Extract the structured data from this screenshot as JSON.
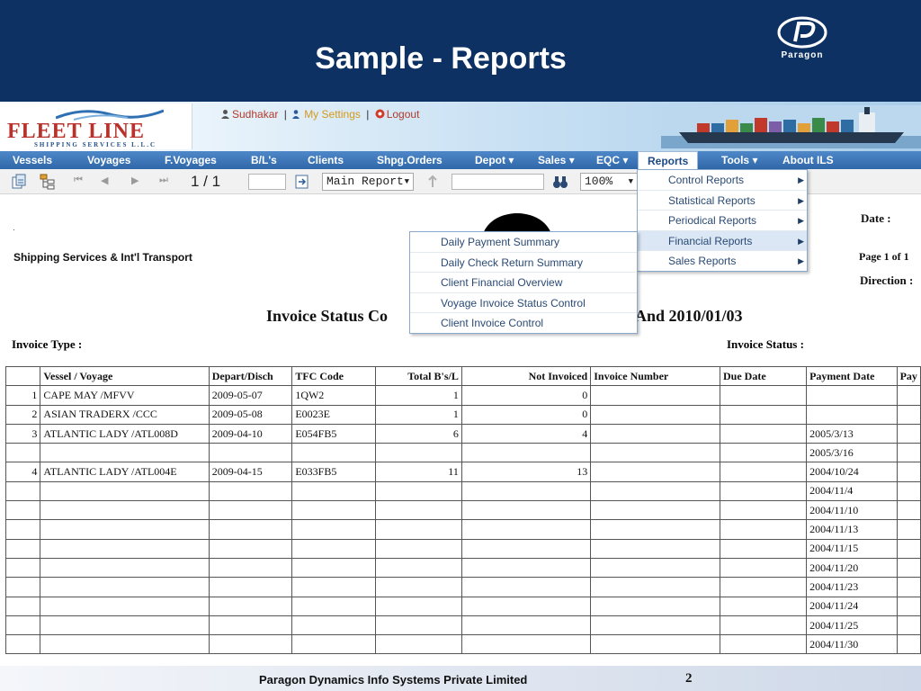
{
  "slide": {
    "title": "Sample - Reports",
    "brand_name": "Paragon",
    "footer": "Paragon Dynamics Info Systems Private Limited",
    "page_number": "2"
  },
  "app": {
    "logo_text": "FLEET LINE",
    "logo_subtext": "SHIPPING SERVICES L.L.C",
    "user_links": [
      "Sudhakar",
      "My Settings",
      "Logout"
    ]
  },
  "nav": [
    "Vessels",
    "Voyages",
    "F.Voyages",
    "B/L's",
    "Clients",
    "Shpg.Orders",
    "Depot ▾",
    "Sales ▾",
    "EQC ▾",
    "Reports",
    "Tools ▾",
    "About ILS"
  ],
  "toolbar": {
    "page_counter": "1 / 1",
    "report_select": "Main Report",
    "zoom": "100%"
  },
  "menus": {
    "reports": [
      "Control Reports",
      "Statistical Reports",
      "Periodical Reports",
      "Financial Reports",
      "Sales Reports"
    ],
    "financial": [
      "Daily Payment Summary",
      "Daily Check Return Summary",
      "Client Financial Overview",
      "Voyage Invoice Status Control",
      "Client Invoice Control"
    ]
  },
  "report": {
    "company": "Shipping Services & Int'l Transport",
    "date_label": "Date :",
    "page_label": "Page 1 of 1",
    "direction_label": "Direction :",
    "title_left": "Invoice Status Co",
    "title_right": "And  2010/01/03",
    "invoice_type_label": "Invoice Type :",
    "invoice_status_label": "Invoice Status :",
    "columns": [
      "",
      "Vessel / Voyage",
      "Depart/Disch",
      "TFC Code",
      "Total B's/L",
      "Not Invoiced",
      "Invoice Number",
      "Due Date",
      "Payment Date",
      "Pay"
    ],
    "rows": [
      [
        "1",
        "CAPE MAY /MFVV",
        "2009-05-07",
        "1QW2",
        "1",
        "0",
        "",
        "",
        "",
        ""
      ],
      [
        "2",
        "ASIAN TRADERX /CCC",
        "2009-05-08",
        "E0023E",
        "1",
        "0",
        "",
        "",
        "",
        ""
      ],
      [
        "3",
        "ATLANTIC LADY /ATL008D",
        "2009-04-10",
        "E054FB5",
        "6",
        "4",
        "",
        "",
        "2005/3/13",
        ""
      ],
      [
        "",
        "",
        "",
        "",
        "",
        "",
        "",
        "",
        "2005/3/16",
        ""
      ],
      [
        "4",
        "ATLANTIC LADY /ATL004E",
        "2009-04-15",
        "E033FB5",
        "11",
        "13",
        "",
        "",
        "2004/10/24",
        ""
      ],
      [
        "",
        "",
        "",
        "",
        "",
        "",
        "",
        "",
        "2004/11/4",
        ""
      ],
      [
        "",
        "",
        "",
        "",
        "",
        "",
        "",
        "",
        "2004/11/10",
        ""
      ],
      [
        "",
        "",
        "",
        "",
        "",
        "",
        "",
        "",
        "2004/11/13",
        ""
      ],
      [
        "",
        "",
        "",
        "",
        "",
        "",
        "",
        "",
        "2004/11/15",
        ""
      ],
      [
        "",
        "",
        "",
        "",
        "",
        "",
        "",
        "",
        "2004/11/20",
        ""
      ],
      [
        "",
        "",
        "",
        "",
        "",
        "",
        "",
        "",
        "2004/11/23",
        ""
      ],
      [
        "",
        "",
        "",
        "",
        "",
        "",
        "",
        "",
        "2004/11/24",
        ""
      ],
      [
        "",
        "",
        "",
        "",
        "",
        "",
        "",
        "",
        "2004/11/25",
        ""
      ],
      [
        "",
        "",
        "",
        "",
        "",
        "",
        "",
        "",
        "2004/11/30",
        ""
      ]
    ]
  }
}
